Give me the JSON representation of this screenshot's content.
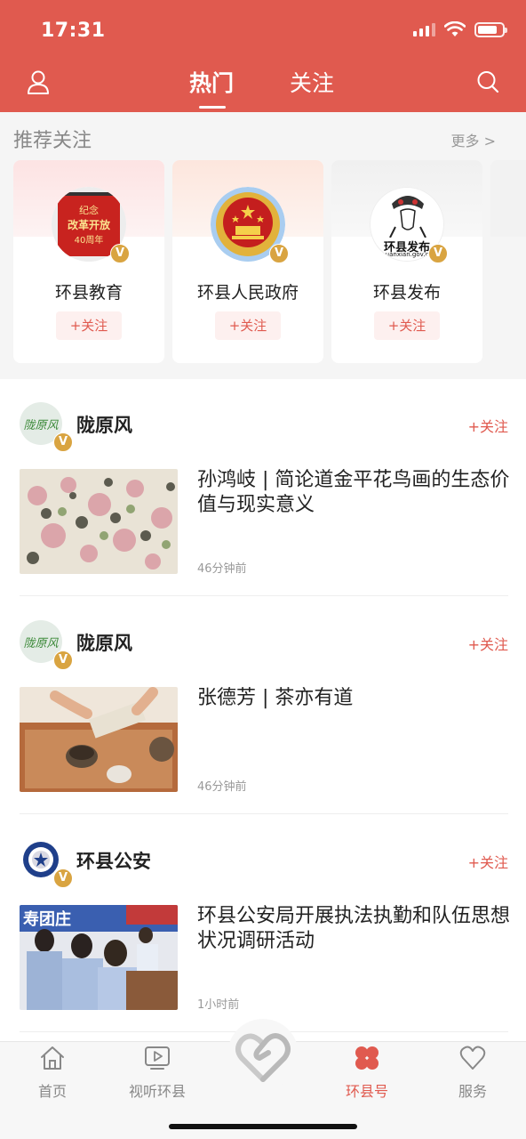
{
  "status_bar": {
    "time": "17:31"
  },
  "nav": {
    "tabs": [
      "热门",
      "关注"
    ],
    "active_tab": "热门"
  },
  "recommend": {
    "title": "推荐关注",
    "more": "更多 >",
    "cards": [
      {
        "name": "环县教育",
        "follow_label": "+关注",
        "avatar_text_1": "纪念",
        "avatar_text_2": "改革开放",
        "avatar_text_3": "40周年"
      },
      {
        "name": "环县人民政府",
        "follow_label": "+关注"
      },
      {
        "name": "环县发布",
        "follow_label": "+关注",
        "avatar_text_1": "环县发布",
        "avatar_text_2": "huanxian.gov.cn"
      }
    ]
  },
  "feed": [
    {
      "author": "陇原风",
      "follow_label": "+关注",
      "avatar_text": "陇原风",
      "title": "孙鸿岐 | 简论道金平花鸟画的生态价值与现实意义",
      "time": "46分钟前"
    },
    {
      "author": "陇原风",
      "follow_label": "+关注",
      "avatar_text": "陇原风",
      "title": "张德芳 | 茶亦有道",
      "time": "46分钟前"
    },
    {
      "author": "环县公安",
      "follow_label": "+关注",
      "title": "环县公安局开展执法执勤和队伍思想状况调研活动",
      "time": "1小时前",
      "thumb_text": "寿团庄"
    }
  ],
  "bottom_nav": {
    "items": [
      {
        "label": "首页",
        "icon": "home-icon"
      },
      {
        "label": "视听环县",
        "icon": "video-icon"
      },
      {
        "label": "",
        "icon": "heart-hands-icon"
      },
      {
        "label": "环县号",
        "icon": "clover-icon",
        "active": true
      },
      {
        "label": "服务",
        "icon": "heart-service-icon"
      }
    ]
  },
  "badge_label": "V",
  "colors": {
    "brand": "#e05a4f",
    "badge": "#d9a441",
    "muted": "#999999"
  }
}
